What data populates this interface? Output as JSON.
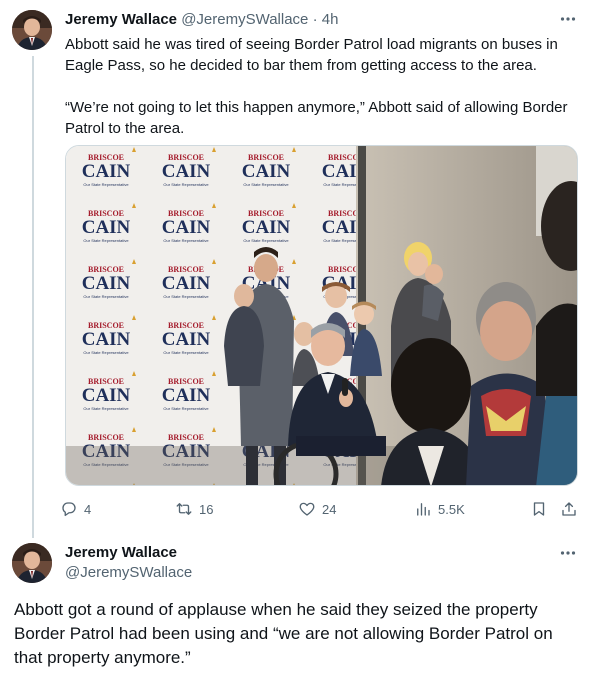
{
  "tweet1": {
    "author_name": "Jeremy Wallace",
    "author_handle": "@JeremySWallace",
    "separator": "·",
    "time": "4h",
    "more_icon": "more-dots-icon",
    "text_p1": "Abbott said he was tired of seeing Border Patrol load migrants on buses in Eagle Pass, so he decided to bar them from getting access to the area.",
    "text_p2": "“We’re not going to let this happen anymore,” Abbott said of allowing Border Patrol to the area.",
    "media": {
      "backdrop_brand_top": "BRISCOE",
      "backdrop_brand_main": "CAIN",
      "backdrop_brand_sub": "Our State Representative"
    },
    "actions": {
      "reply_count": "4",
      "retweet_count": "16",
      "like_count": "24",
      "views_count": "5.5K"
    }
  },
  "tweet2": {
    "author_name": "Jeremy Wallace",
    "author_handle": "@JeremySWallace",
    "text": "Abbott got a round of applause when he said they seized the property Border Patrol had been using and “we are not allowing Border Patrol on that property anymore.”"
  },
  "colors": {
    "text_primary": "#0f1419",
    "text_secondary": "#536471",
    "thread_line": "#cfd9de",
    "brand_red": "#a51c2c",
    "brand_blue": "#1f2f5a"
  }
}
